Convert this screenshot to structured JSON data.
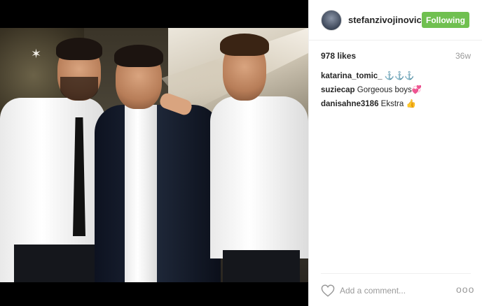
{
  "post": {
    "username": "stefanzivojinovic",
    "follow_label": "Following",
    "likes": "978 likes",
    "time_ago": "36w",
    "comments": [
      {
        "author": "katarina_tomic_",
        "text": "⚓⚓⚓"
      },
      {
        "author": "suziecap",
        "text": "Gorgeous boys💞"
      },
      {
        "author": "danisahne3186",
        "text": "Ekstra 👍"
      }
    ],
    "comment_placeholder": "Add a comment...",
    "more_label": "ooo"
  },
  "colors": {
    "follow_button": "#70c050",
    "text_primary": "#262626",
    "text_muted": "#999999"
  },
  "icons": {
    "like": "heart-outline-icon",
    "more": "more-options-icon"
  }
}
